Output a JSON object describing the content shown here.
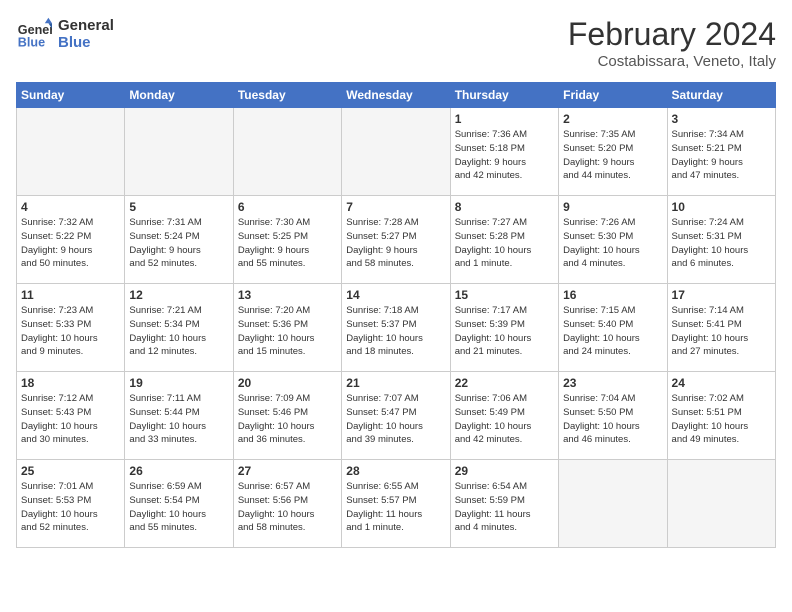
{
  "header": {
    "logo_line1": "General",
    "logo_line2": "Blue",
    "title": "February 2024",
    "subtitle": "Costabissara, Veneto, Italy"
  },
  "weekdays": [
    "Sunday",
    "Monday",
    "Tuesday",
    "Wednesday",
    "Thursday",
    "Friday",
    "Saturday"
  ],
  "weeks": [
    [
      {
        "num": "",
        "detail": "",
        "empty": true
      },
      {
        "num": "",
        "detail": "",
        "empty": true
      },
      {
        "num": "",
        "detail": "",
        "empty": true
      },
      {
        "num": "",
        "detail": "",
        "empty": true
      },
      {
        "num": "1",
        "detail": "Sunrise: 7:36 AM\nSunset: 5:18 PM\nDaylight: 9 hours\nand 42 minutes."
      },
      {
        "num": "2",
        "detail": "Sunrise: 7:35 AM\nSunset: 5:20 PM\nDaylight: 9 hours\nand 44 minutes."
      },
      {
        "num": "3",
        "detail": "Sunrise: 7:34 AM\nSunset: 5:21 PM\nDaylight: 9 hours\nand 47 minutes."
      }
    ],
    [
      {
        "num": "4",
        "detail": "Sunrise: 7:32 AM\nSunset: 5:22 PM\nDaylight: 9 hours\nand 50 minutes."
      },
      {
        "num": "5",
        "detail": "Sunrise: 7:31 AM\nSunset: 5:24 PM\nDaylight: 9 hours\nand 52 minutes."
      },
      {
        "num": "6",
        "detail": "Sunrise: 7:30 AM\nSunset: 5:25 PM\nDaylight: 9 hours\nand 55 minutes."
      },
      {
        "num": "7",
        "detail": "Sunrise: 7:28 AM\nSunset: 5:27 PM\nDaylight: 9 hours\nand 58 minutes."
      },
      {
        "num": "8",
        "detail": "Sunrise: 7:27 AM\nSunset: 5:28 PM\nDaylight: 10 hours\nand 1 minute."
      },
      {
        "num": "9",
        "detail": "Sunrise: 7:26 AM\nSunset: 5:30 PM\nDaylight: 10 hours\nand 4 minutes."
      },
      {
        "num": "10",
        "detail": "Sunrise: 7:24 AM\nSunset: 5:31 PM\nDaylight: 10 hours\nand 6 minutes."
      }
    ],
    [
      {
        "num": "11",
        "detail": "Sunrise: 7:23 AM\nSunset: 5:33 PM\nDaylight: 10 hours\nand 9 minutes."
      },
      {
        "num": "12",
        "detail": "Sunrise: 7:21 AM\nSunset: 5:34 PM\nDaylight: 10 hours\nand 12 minutes."
      },
      {
        "num": "13",
        "detail": "Sunrise: 7:20 AM\nSunset: 5:36 PM\nDaylight: 10 hours\nand 15 minutes."
      },
      {
        "num": "14",
        "detail": "Sunrise: 7:18 AM\nSunset: 5:37 PM\nDaylight: 10 hours\nand 18 minutes."
      },
      {
        "num": "15",
        "detail": "Sunrise: 7:17 AM\nSunset: 5:39 PM\nDaylight: 10 hours\nand 21 minutes."
      },
      {
        "num": "16",
        "detail": "Sunrise: 7:15 AM\nSunset: 5:40 PM\nDaylight: 10 hours\nand 24 minutes."
      },
      {
        "num": "17",
        "detail": "Sunrise: 7:14 AM\nSunset: 5:41 PM\nDaylight: 10 hours\nand 27 minutes."
      }
    ],
    [
      {
        "num": "18",
        "detail": "Sunrise: 7:12 AM\nSunset: 5:43 PM\nDaylight: 10 hours\nand 30 minutes."
      },
      {
        "num": "19",
        "detail": "Sunrise: 7:11 AM\nSunset: 5:44 PM\nDaylight: 10 hours\nand 33 minutes."
      },
      {
        "num": "20",
        "detail": "Sunrise: 7:09 AM\nSunset: 5:46 PM\nDaylight: 10 hours\nand 36 minutes."
      },
      {
        "num": "21",
        "detail": "Sunrise: 7:07 AM\nSunset: 5:47 PM\nDaylight: 10 hours\nand 39 minutes."
      },
      {
        "num": "22",
        "detail": "Sunrise: 7:06 AM\nSunset: 5:49 PM\nDaylight: 10 hours\nand 42 minutes."
      },
      {
        "num": "23",
        "detail": "Sunrise: 7:04 AM\nSunset: 5:50 PM\nDaylight: 10 hours\nand 46 minutes."
      },
      {
        "num": "24",
        "detail": "Sunrise: 7:02 AM\nSunset: 5:51 PM\nDaylight: 10 hours\nand 49 minutes."
      }
    ],
    [
      {
        "num": "25",
        "detail": "Sunrise: 7:01 AM\nSunset: 5:53 PM\nDaylight: 10 hours\nand 52 minutes."
      },
      {
        "num": "26",
        "detail": "Sunrise: 6:59 AM\nSunset: 5:54 PM\nDaylight: 10 hours\nand 55 minutes."
      },
      {
        "num": "27",
        "detail": "Sunrise: 6:57 AM\nSunset: 5:56 PM\nDaylight: 10 hours\nand 58 minutes."
      },
      {
        "num": "28",
        "detail": "Sunrise: 6:55 AM\nSunset: 5:57 PM\nDaylight: 11 hours\nand 1 minute."
      },
      {
        "num": "29",
        "detail": "Sunrise: 6:54 AM\nSunset: 5:59 PM\nDaylight: 11 hours\nand 4 minutes."
      },
      {
        "num": "",
        "detail": "",
        "empty": true
      },
      {
        "num": "",
        "detail": "",
        "empty": true
      }
    ]
  ]
}
